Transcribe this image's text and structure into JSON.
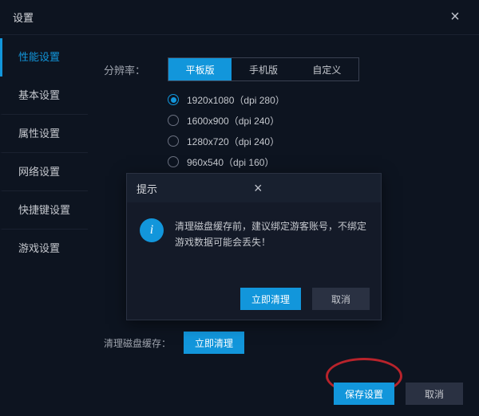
{
  "window": {
    "title": "设置"
  },
  "sidebar": {
    "tabs": [
      {
        "label": "性能设置",
        "active": true
      },
      {
        "label": "基本设置"
      },
      {
        "label": "属性设置"
      },
      {
        "label": "网络设置"
      },
      {
        "label": "快捷键设置"
      },
      {
        "label": "游戏设置"
      }
    ]
  },
  "resolution": {
    "label": "分辨率：",
    "segments": [
      {
        "label": "平板版",
        "active": true
      },
      {
        "label": "手机版"
      },
      {
        "label": "自定义"
      }
    ],
    "options": [
      {
        "label": "1920x1080（dpi 280）",
        "selected": true
      },
      {
        "label": "1600x900（dpi 240）"
      },
      {
        "label": "1280x720（dpi 240）"
      },
      {
        "label": "960x540（dpi 160）"
      }
    ]
  },
  "clearCache": {
    "label": "清理磁盘缓存：",
    "button": "立即清理"
  },
  "footer": {
    "save": "保存设置",
    "cancel": "取消"
  },
  "dialog": {
    "title": "提示",
    "message": "清理磁盘缓存前，建议绑定游客账号，不绑定游戏数据可能会丢失！",
    "confirm": "立即清理",
    "cancel": "取消"
  }
}
